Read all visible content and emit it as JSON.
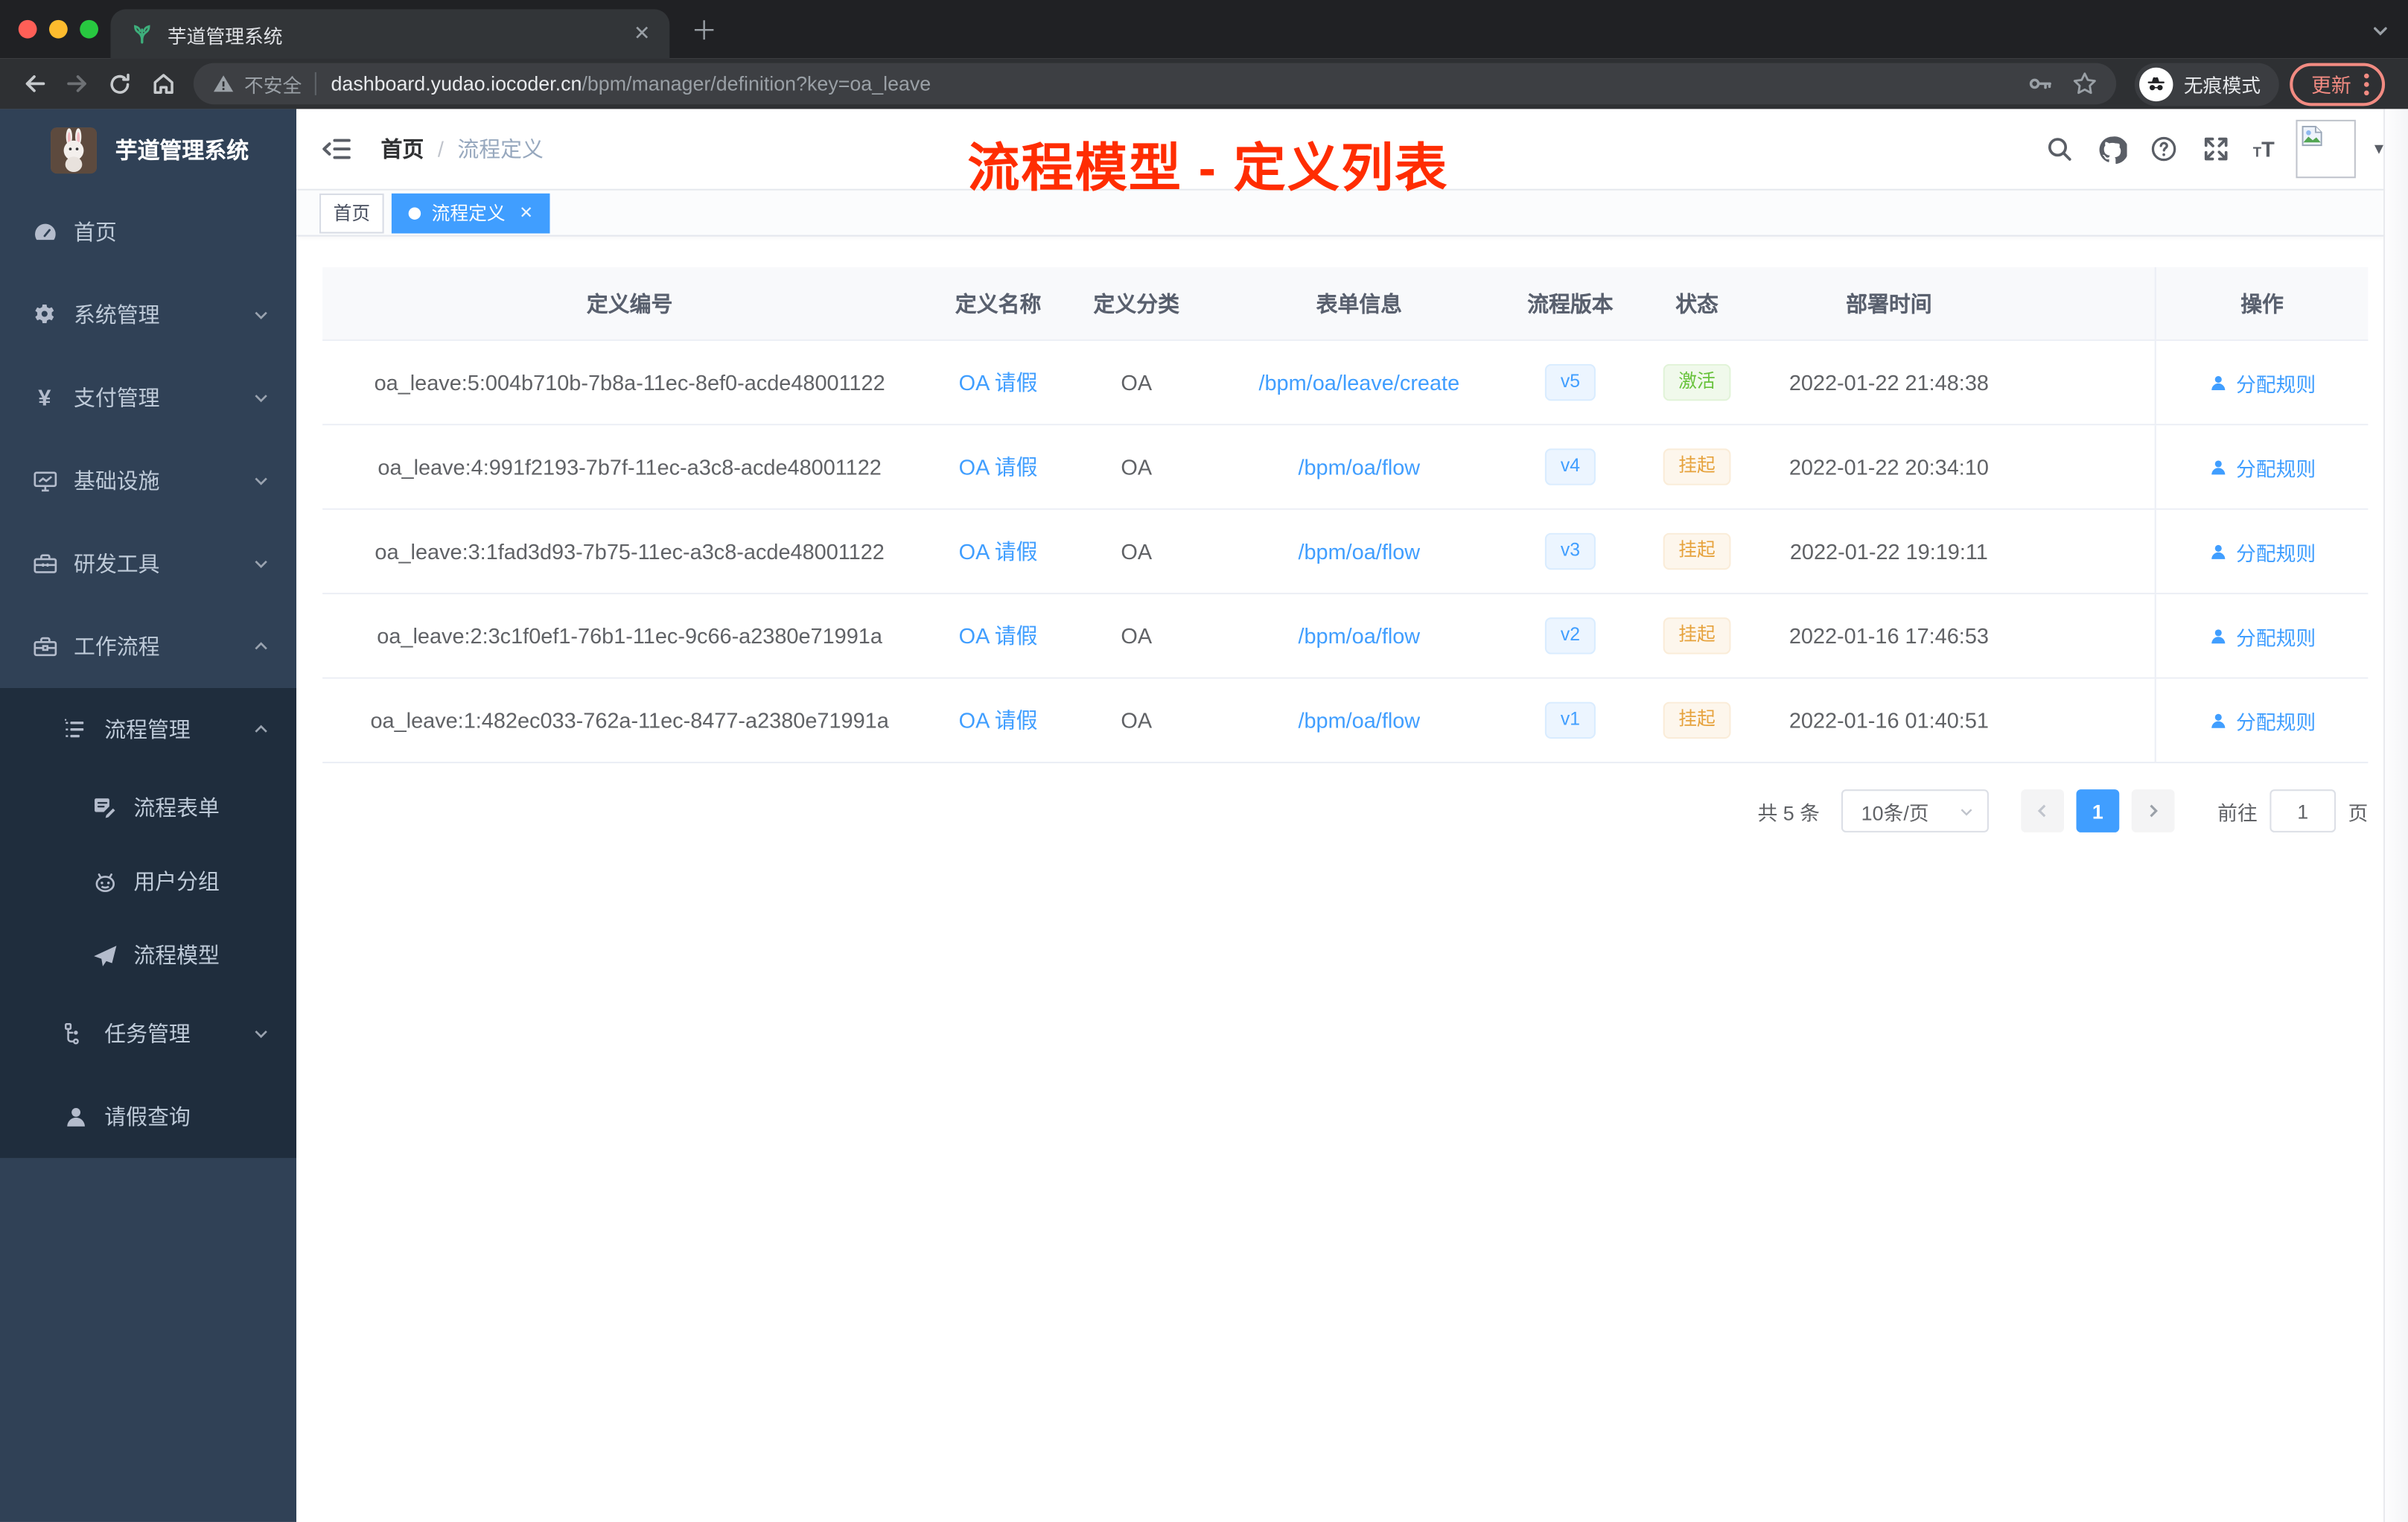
{
  "browser": {
    "tab_title": "芋道管理系统",
    "security_label": "不安全",
    "url_host": "dashboard.yudao.iocoder.cn",
    "url_path": "/bpm/manager/definition?key=oa_leave",
    "incognito_label": "无痕模式",
    "update_label": "更新"
  },
  "sidebar": {
    "logo_title": "芋道管理系统",
    "items": [
      {
        "label": "首页"
      },
      {
        "label": "系统管理"
      },
      {
        "label": "支付管理"
      },
      {
        "label": "基础设施"
      },
      {
        "label": "研发工具"
      },
      {
        "label": "工作流程"
      },
      {
        "label": "流程管理"
      },
      {
        "label": "流程表单"
      },
      {
        "label": "用户分组"
      },
      {
        "label": "流程模型"
      },
      {
        "label": "任务管理"
      },
      {
        "label": "请假查询"
      }
    ]
  },
  "header": {
    "breadcrumb_home": "首页",
    "breadcrumb_separator": "/",
    "breadcrumb_current": "流程定义",
    "annotation": "流程模型 - 定义列表"
  },
  "tags": [
    {
      "label": "首页"
    },
    {
      "label": "流程定义"
    }
  ],
  "table": {
    "columns": [
      "定义编号",
      "定义名称",
      "定义分类",
      "表单信息",
      "流程版本",
      "状态",
      "部署时间",
      "操作"
    ],
    "rows": [
      {
        "id": "oa_leave:5:004b710b-7b8a-11ec-8ef0-acde48001122",
        "name": "OA 请假",
        "category": "OA",
        "form": "/bpm/oa/leave/create",
        "version": "v5",
        "status": "激活",
        "status_type": "success",
        "time": "2022-01-22 21:48:38",
        "action": "分配规则"
      },
      {
        "id": "oa_leave:4:991f2193-7b7f-11ec-a3c8-acde48001122",
        "name": "OA 请假",
        "category": "OA",
        "form": "/bpm/oa/flow",
        "version": "v4",
        "status": "挂起",
        "status_type": "warning",
        "time": "2022-01-22 20:34:10",
        "action": "分配规则"
      },
      {
        "id": "oa_leave:3:1fad3d93-7b75-11ec-a3c8-acde48001122",
        "name": "OA 请假",
        "category": "OA",
        "form": "/bpm/oa/flow",
        "version": "v3",
        "status": "挂起",
        "status_type": "warning",
        "time": "2022-01-22 19:19:11",
        "action": "分配规则"
      },
      {
        "id": "oa_leave:2:3c1f0ef1-76b1-11ec-9c66-a2380e71991a",
        "name": "OA 请假",
        "category": "OA",
        "form": "/bpm/oa/flow",
        "version": "v2",
        "status": "挂起",
        "status_type": "warning",
        "time": "2022-01-16 17:46:53",
        "action": "分配规则"
      },
      {
        "id": "oa_leave:1:482ec033-762a-11ec-8477-a2380e71991a",
        "name": "OA 请假",
        "category": "OA",
        "form": "/bpm/oa/flow",
        "version": "v1",
        "status": "挂起",
        "status_type": "warning",
        "time": "2022-01-16 01:40:51",
        "action": "分配规则"
      }
    ]
  },
  "pagination": {
    "total": "共 5 条",
    "page_size": "10条/页",
    "current_page": "1",
    "goto_label": "前往",
    "goto_value": "1",
    "page_unit": "页"
  },
  "colors": {
    "accent_blue": "#409eff",
    "sidebar_bg": "#304156",
    "submenu_bg": "#1f2d3d",
    "status_active_green": "#67c23a",
    "status_suspend_yellow": "#e6a23c",
    "annotation_red": "#ff2d02",
    "tag_active_blue": "#409eff",
    "chrome_update_red": "#f28b82"
  }
}
